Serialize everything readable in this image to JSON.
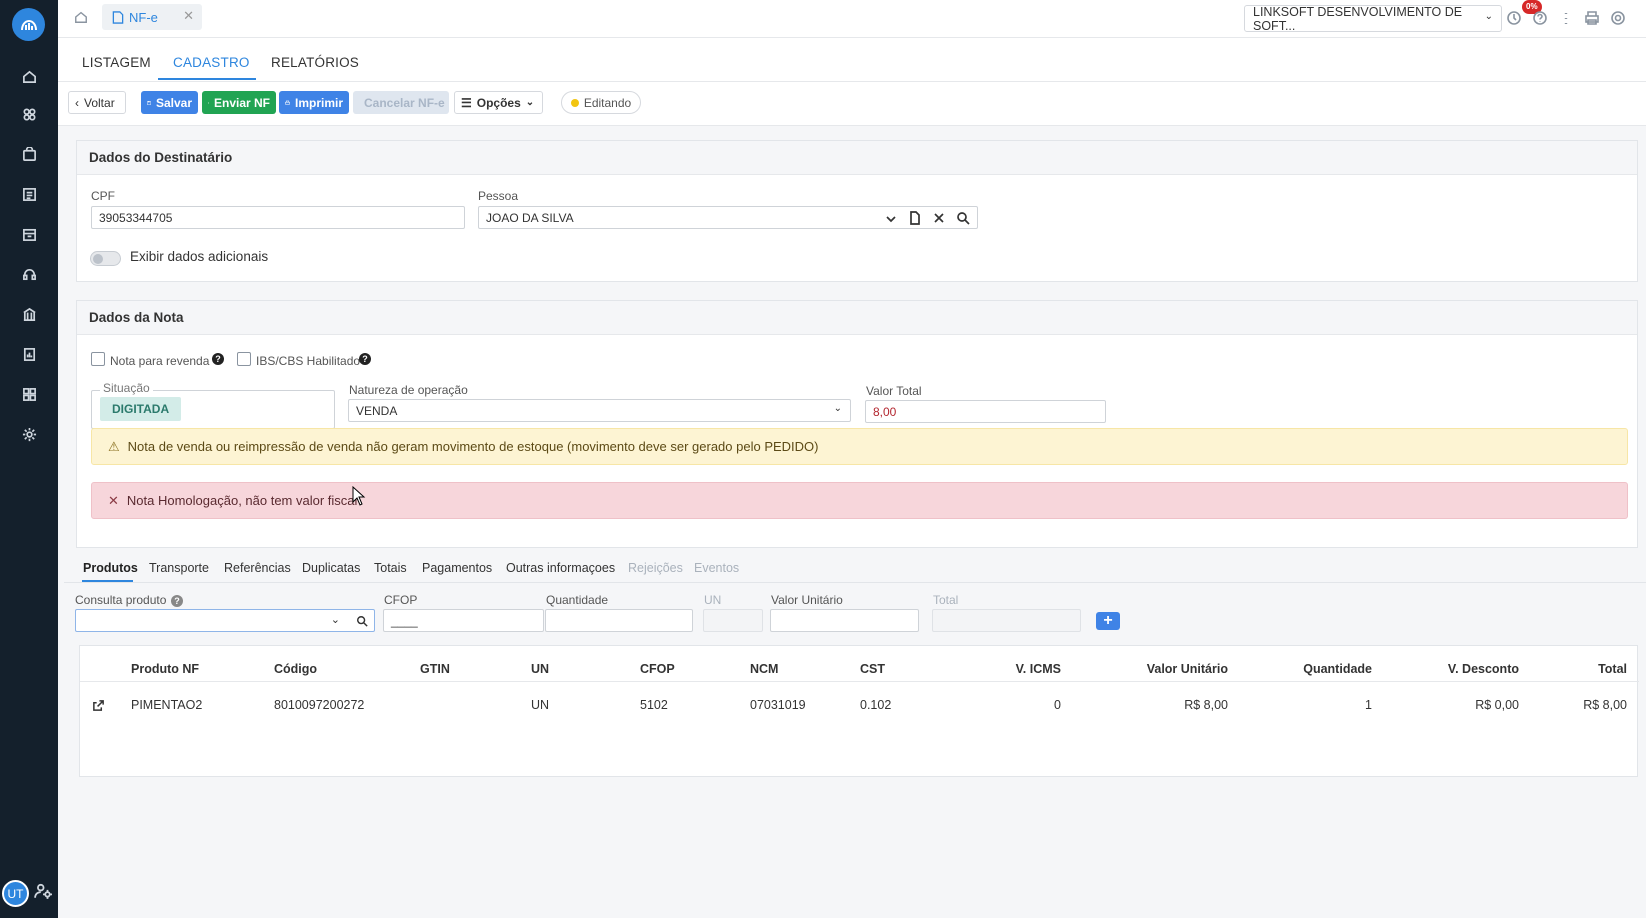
{
  "topbar": {
    "tab_label": "NF-e",
    "tab_close": "✕",
    "company": "LINKSOFT DESENVOLVIMENTO DE SOFT...",
    "notif_badge": "0%"
  },
  "user": {
    "initials": "UT"
  },
  "main_tabs": [
    "LISTAGEM",
    "CADASTRO",
    "RELATÓRIOS"
  ],
  "toolbar": {
    "back": "Voltar",
    "save": "Salvar",
    "send": "Enviar NF",
    "print": "Imprimir",
    "cancel": "Cancelar NF-e",
    "options": "Opções",
    "status": "Editando"
  },
  "destinatario": {
    "title": "Dados do Destinatário",
    "cpf_label": "CPF",
    "cpf_value": "39053344705",
    "pessoa_label": "Pessoa",
    "pessoa_value": "JOAO DA SILVA",
    "toggle_label": "Exibir dados adicionais"
  },
  "nota": {
    "title": "Dados da Nota",
    "revenda_label": "Nota para revenda",
    "ibs_label": "IBS/CBS Habilitado",
    "situacao_label": "Situação",
    "situacao_value": "DIGITADA",
    "natureza_label": "Natureza de operação",
    "natureza_value": "VENDA",
    "valor_label": "Valor Total",
    "valor_value": "8,00",
    "warning": "Nota de venda ou reimpressão de venda não geram movimento de estoque (movimento deve ser gerado pelo PEDIDO)",
    "error": "Nota Homologação, não tem valor fiscal"
  },
  "product_tabs": [
    "Produtos",
    "Transporte",
    "Referências",
    "Duplicatas",
    "Totais",
    "Pagamentos",
    "Outras informaçoes",
    "Rejeições",
    "Eventos"
  ],
  "product_form": {
    "consulta_label": "Consulta produto",
    "cfop_label": "CFOP",
    "cfop_placeholder": "____",
    "qtd_label": "Quantidade",
    "un_label": "UN",
    "vunit_label": "Valor Unitário",
    "total_label": "Total",
    "add": "+"
  },
  "table": {
    "columns": [
      "Produto NF",
      "Código",
      "GTIN",
      "UN",
      "CFOP",
      "NCM",
      "CST",
      "V. ICMS",
      "Valor Unitário",
      "Quantidade",
      "V. Desconto",
      "Total"
    ],
    "rows": [
      [
        "PIMENTAO2",
        "8010097200272",
        "",
        "UN",
        "5102",
        "07031019",
        "0.102",
        "0",
        "R$ 8,00",
        "1",
        "R$ 0,00",
        "R$ 8,00"
      ]
    ]
  }
}
